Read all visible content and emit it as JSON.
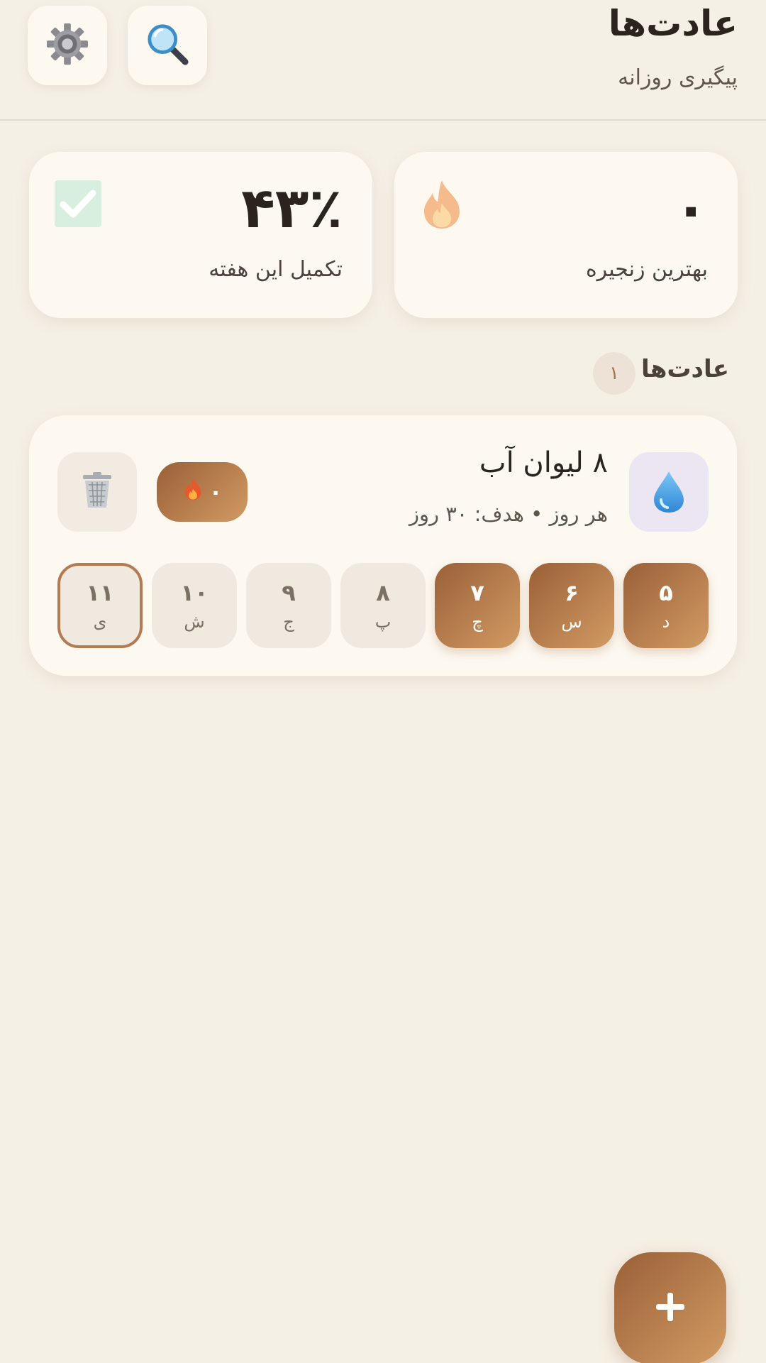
{
  "header": {
    "title": "عادت‌ها",
    "subtitle": "پیگیری روزانه",
    "settings_icon": "gear-icon",
    "search_icon": "search-icon"
  },
  "stats": {
    "weekly_completion": {
      "value": "۴۳٪",
      "label": "تکمیل این هفته",
      "icon": "check-box-icon"
    },
    "best_streak": {
      "value": "۰",
      "label": "بهترین زنجیره",
      "icon": "flame-icon"
    }
  },
  "habits_section": {
    "title": "عادت‌ها",
    "count": "۱"
  },
  "habits": [
    {
      "name": "۸ لیوان آب",
      "meta": "هر روز • هدف: ۳۰ روز",
      "icon": "water-drop-icon",
      "streak": "۰",
      "days": [
        {
          "num": "۵",
          "abbr": "د",
          "state": "done"
        },
        {
          "num": "۶",
          "abbr": "س",
          "state": "done"
        },
        {
          "num": "۷",
          "abbr": "چ",
          "state": "done"
        },
        {
          "num": "۸",
          "abbr": "پ",
          "state": "empty"
        },
        {
          "num": "۹",
          "abbr": "ج",
          "state": "empty"
        },
        {
          "num": "۱۰",
          "abbr": "ش",
          "state": "empty"
        },
        {
          "num": "۱۱",
          "abbr": "ی",
          "state": "today"
        }
      ]
    }
  ],
  "fab": {
    "label": "+"
  },
  "colors": {
    "background": "#f5f0e6",
    "card": "#fdf9f1",
    "accent_start": "#9a6038",
    "accent_end": "#d19b63",
    "text": "#2b241c"
  }
}
